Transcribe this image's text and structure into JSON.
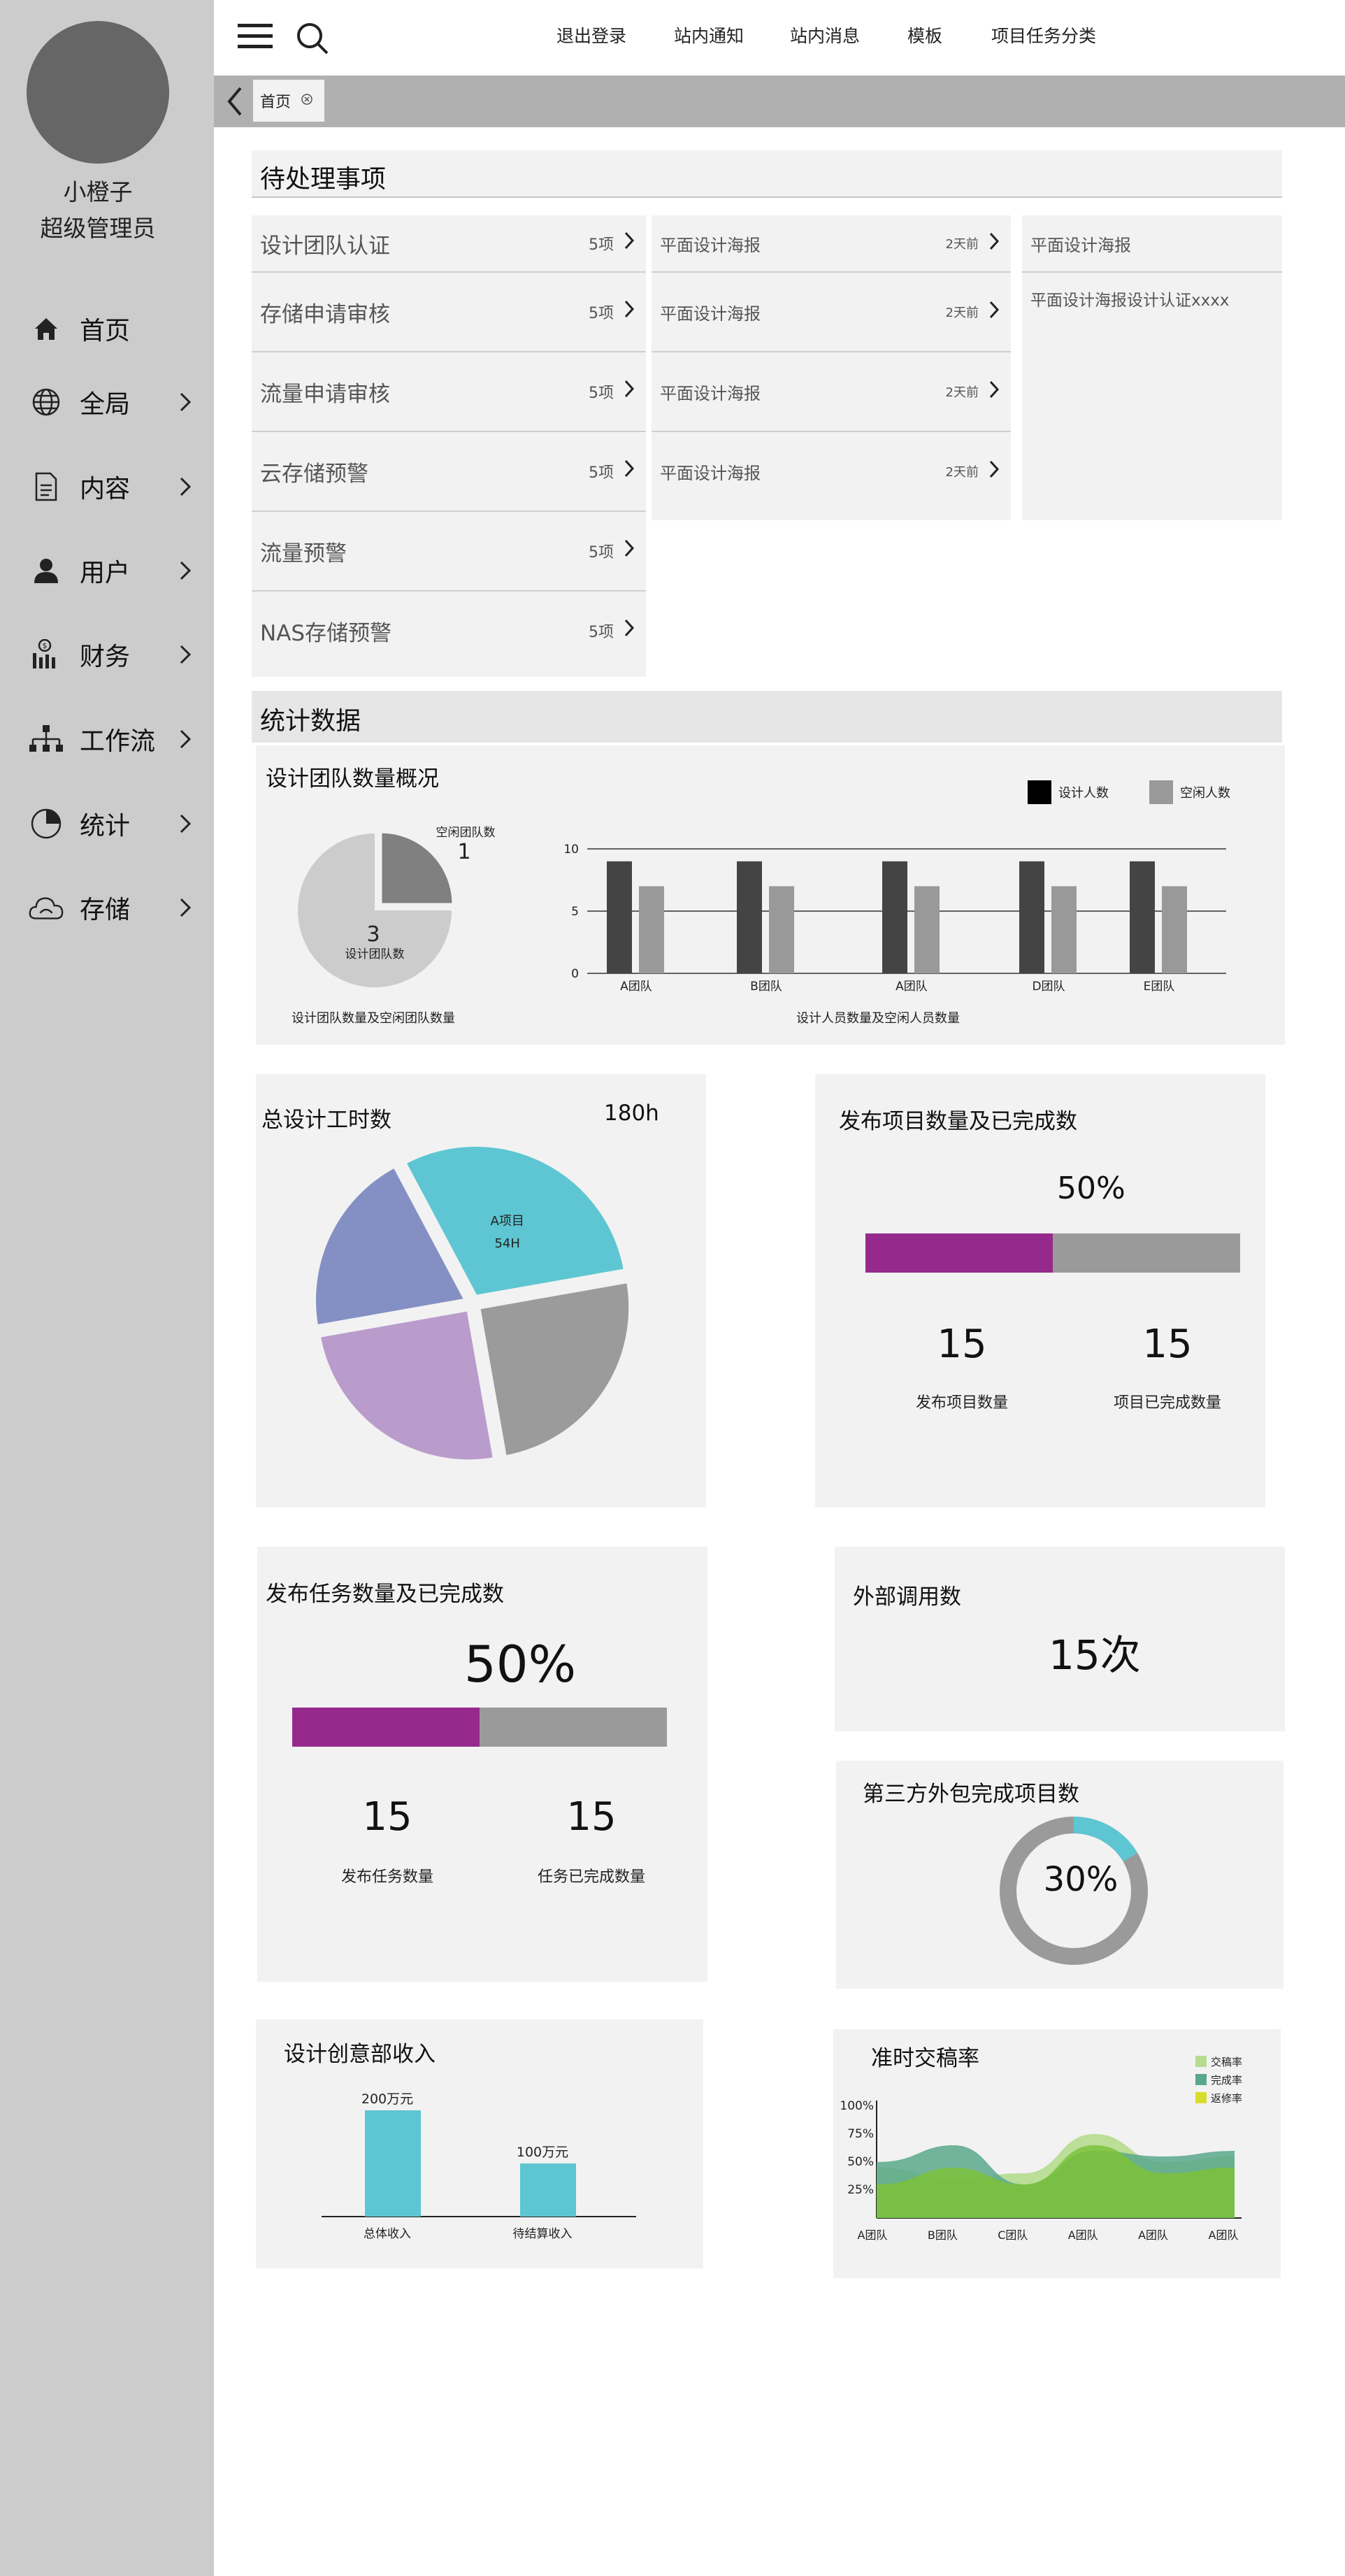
{
  "sidebar": {
    "user_name": "小橙子",
    "user_role": "超级管理员",
    "items": [
      {
        "label": "首页",
        "icon": "home-icon"
      },
      {
        "label": "全局",
        "icon": "globe-icon"
      },
      {
        "label": "内容",
        "icon": "document-icon"
      },
      {
        "label": "用户",
        "icon": "user-icon"
      },
      {
        "label": "财务",
        "icon": "finance-icon"
      },
      {
        "label": "工作流",
        "icon": "workflow-icon"
      },
      {
        "label": "统计",
        "icon": "pie-chart-icon"
      },
      {
        "label": "存储",
        "icon": "cloud-icon"
      }
    ]
  },
  "topbar": {
    "links": [
      "退出登录",
      "站内通知",
      "站内消息",
      "模板",
      "项目任务分类"
    ]
  },
  "tabs": [
    {
      "label": "首页"
    }
  ],
  "pending": {
    "title": "待处理事项",
    "items": [
      {
        "label": "设计团队认证",
        "count": "5项"
      },
      {
        "label": "存储申请审核",
        "count": "5项"
      },
      {
        "label": "流量申请审核",
        "count": "5项"
      },
      {
        "label": "云存储预警",
        "count": "5项"
      },
      {
        "label": "流量预警",
        "count": "5项"
      },
      {
        "label": "NAS存储预警",
        "count": "5项"
      }
    ],
    "messages": [
      {
        "label": "平面设计海报",
        "time": "2天前"
      },
      {
        "label": "平面设计海报",
        "time": "2天前"
      },
      {
        "label": "平面设计海报",
        "time": "2天前"
      },
      {
        "label": "平面设计海报",
        "time": "2天前"
      }
    ],
    "detail": {
      "title": "平面设计海报",
      "body": "平面设计海报设计认证xxxx"
    }
  },
  "stats": {
    "title": "统计数据",
    "team_card_title": "设计团队数量概况"
  },
  "colors": {
    "purple": "#962a8c",
    "gray_bar": "#9a9a9a",
    "teal": "#5ec6d2",
    "pie_blue": "#8490c4",
    "pie_lilac": "#b99ccc",
    "pie_gray": "#9b9b9b",
    "dark_bar": "#444444"
  },
  "projects": {
    "title": "发布项目数量及已完成数",
    "percent_label": "50%",
    "percent": 0.5,
    "published": "15",
    "published_label": "发布项目数量",
    "completed": "15",
    "completed_label": "项目已完成数量"
  },
  "tasks": {
    "title": "发布任务数量及已完成数",
    "percent_label": "50%",
    "percent": 0.5,
    "published": "15",
    "published_label": "发布任务数量",
    "completed": "15",
    "completed_label": "任务已完成数量"
  },
  "external": {
    "title": "外部调用数",
    "value": "15次"
  },
  "outsourcing": {
    "title": "第三方外包完成项目数",
    "percent_label": "30%",
    "percent": 0.3
  },
  "chart_data": [
    {
      "type": "pie",
      "caption": "设计团队数量及空闲团队数量",
      "slices": [
        {
          "label": "设计团队数",
          "value": 3
        },
        {
          "label": "空闲团队数",
          "value": 1
        }
      ]
    },
    {
      "type": "bar",
      "caption": "设计人员数量及空闲人员数量",
      "categories": [
        "A团队",
        "B团队",
        "A团队",
        "D团队",
        "E团队"
      ],
      "series": [
        {
          "name": "设计人数",
          "values": [
            9,
            9,
            9,
            9,
            9
          ]
        },
        {
          "name": "空闲人数",
          "values": [
            7,
            7,
            7,
            7,
            7
          ]
        }
      ],
      "yticks": [
        0,
        5,
        10
      ],
      "ylim": [
        0,
        10
      ],
      "legend": "top-right"
    },
    {
      "type": "pie",
      "title": "总设计工时数",
      "total_label": "180h",
      "slices": [
        {
          "label": "A项目",
          "value_label": "54H",
          "value": 54
        },
        {
          "label": "",
          "value": 45
        },
        {
          "label": "",
          "value": 45
        },
        {
          "label": "",
          "value": 36
        }
      ]
    },
    {
      "type": "bar",
      "title": "设计创意部收入",
      "categories": [
        "总体收入",
        "待结算收入"
      ],
      "values": [
        200,
        100
      ],
      "value_labels": [
        "200万元",
        "100万元"
      ]
    },
    {
      "type": "area",
      "title": "准时交稿率",
      "categories": [
        "A团队",
        "B团队",
        "C团队",
        "A团队",
        "A团队",
        "A团队"
      ],
      "yticks": [
        "25%",
        "50%",
        "75%",
        "100%"
      ],
      "ylim": [
        0,
        100
      ],
      "legend": "top-right",
      "series": [
        {
          "name": "交稿率",
          "values": [
            45,
            35,
            40,
            75,
            50,
            55
          ]
        },
        {
          "name": "完成率",
          "values": [
            50,
            65,
            30,
            60,
            55,
            60
          ]
        },
        {
          "name": "返修率",
          "values": [
            30,
            45,
            30,
            65,
            40,
            45
          ]
        }
      ]
    }
  ]
}
